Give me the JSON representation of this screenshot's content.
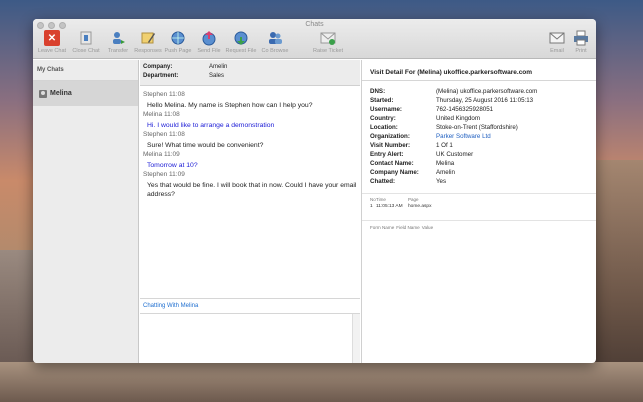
{
  "window": {
    "title": "Chats"
  },
  "toolbar": {
    "leave_chat": "Leave Chat",
    "close_chat": "Close Chat",
    "transfer": "Transfer",
    "responses": "Responses",
    "push_page": "Push Page",
    "send_file": "Send File",
    "request_file": "Request File",
    "co_browse": "Co Browse",
    "raise_ticket": "Raise Ticket",
    "email": "Email",
    "print": "Print"
  },
  "sidebar": {
    "header": "My Chats",
    "items": [
      {
        "label": "Melina"
      }
    ]
  },
  "chat": {
    "company_label": "Company:",
    "company_value": "Amelin",
    "department_label": "Department:",
    "department_value": "Sales",
    "messages": [
      {
        "meta": "Stephen 11:08",
        "text": "Hello Melina. My name is Stephen how can I help you?"
      },
      {
        "meta": "Melina 11:08",
        "text": "Hi. I would like to arrange a demonstration"
      },
      {
        "meta": "Stephen 11:08",
        "text": "Sure! What time would be convenient?"
      },
      {
        "meta": "Melina 11:09",
        "text": "Tomorrow at 10?"
      },
      {
        "meta": "Stephen 11:09",
        "text": "Yes that would be fine. I will book that in now. Could I have your email address?"
      }
    ],
    "chatting_with": "Chatting With Melina"
  },
  "detail": {
    "title": "Visit Detail For (Melina) ukoffice.parkersoftware.com",
    "rows": [
      {
        "k": "DNS:",
        "v": "(Melina) ukoffice.parkersoftware.com"
      },
      {
        "k": "Started:",
        "v": "Thursday, 25 August 2016 11:05:13"
      },
      {
        "k": "Username:",
        "v": "762-1456325928051"
      },
      {
        "k": "Country:",
        "v": "United Kingdom"
      },
      {
        "k": "Location:",
        "v": "Stoke-on-Trent (Staffordshire)"
      },
      {
        "k": "Organization:",
        "v": "Parker Software Ltd"
      },
      {
        "k": "Visit Number:",
        "v": "1 Of 1"
      },
      {
        "k": "Entry Alert:",
        "v": "UK Customer"
      },
      {
        "k": "Contact Name:",
        "v": "Melina"
      },
      {
        "k": "Company Name:",
        "v": "Amelin"
      },
      {
        "k": "Chatted:",
        "v": "Yes"
      }
    ],
    "visits_header": {
      "no": "No",
      "time": "Time",
      "page": "Page"
    },
    "visits": [
      {
        "no": "1",
        "time": "11:05:13 AM",
        "page": "home.aspx"
      }
    ],
    "form_header": {
      "name": "Form Name",
      "field": "Field Name",
      "value": "Value"
    }
  },
  "colors": {
    "leave_chat": "#d9412e",
    "link_blue": "#1f5fc0",
    "melina_text": "#1a1ad6"
  }
}
